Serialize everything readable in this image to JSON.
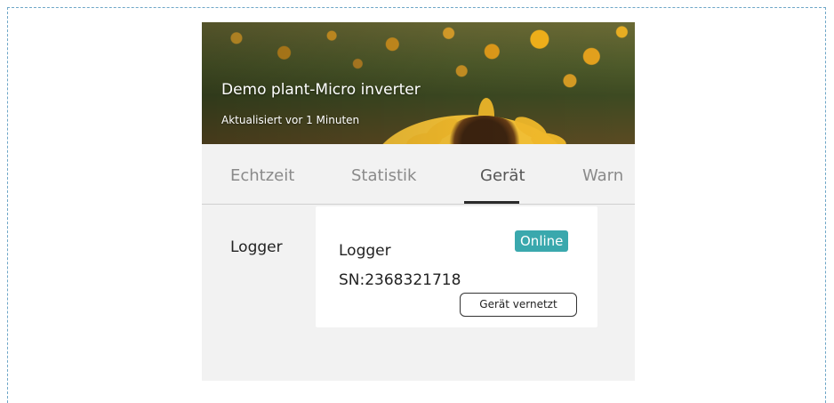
{
  "plant": {
    "name": "Demo plant-Micro inverter",
    "updated": "Aktualisiert vor 1 Minuten"
  },
  "tabs": [
    {
      "label": "Echtzeit",
      "active": false
    },
    {
      "label": "Statistik",
      "active": false
    },
    {
      "label": "Gerät",
      "active": true
    },
    {
      "label": "Warn",
      "active": false
    }
  ],
  "device_section": {
    "category_label": "Logger",
    "device": {
      "name": "Logger",
      "serial": "SN:2368321718",
      "status": "Online",
      "action_label": "Gerät vernetzt"
    }
  },
  "colors": {
    "status_online": "#3aa8ad",
    "frame_border": "#6fa7c8",
    "panel_bg": "#f2f2f2"
  }
}
